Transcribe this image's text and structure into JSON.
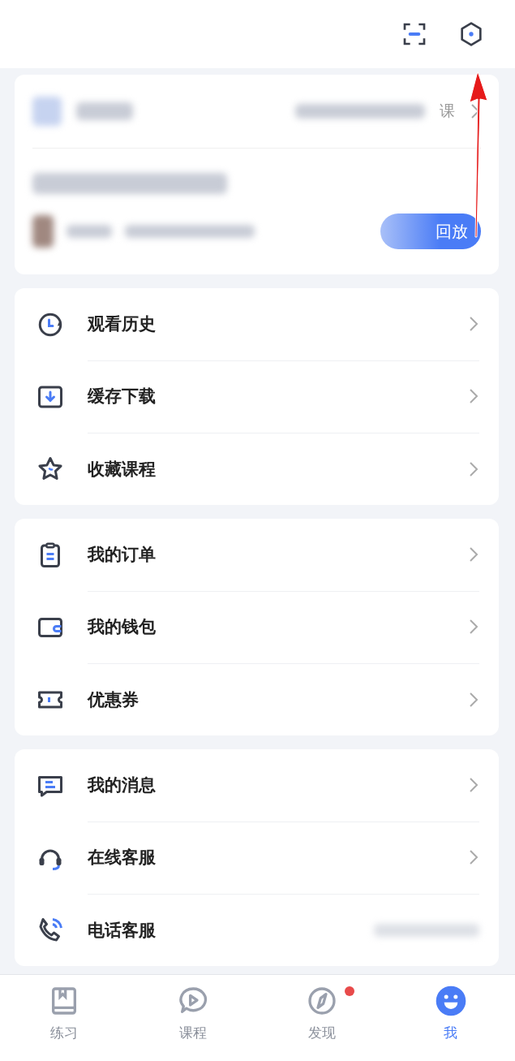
{
  "course_card": {
    "more_suffix": "课",
    "action_button": "回放"
  },
  "menu_groups": [
    {
      "items": [
        {
          "label": "观看历史",
          "chevron": true
        },
        {
          "label": "缓存下载",
          "chevron": true
        },
        {
          "label": "收藏课程",
          "chevron": true
        }
      ]
    },
    {
      "items": [
        {
          "label": "我的订单",
          "chevron": true
        },
        {
          "label": "我的钱包",
          "chevron": true
        },
        {
          "label": "优惠券",
          "chevron": true
        }
      ]
    },
    {
      "items": [
        {
          "label": "我的消息",
          "chevron": true
        },
        {
          "label": "在线客服",
          "chevron": true
        },
        {
          "label": "电话客服",
          "chevron": false
        }
      ]
    }
  ],
  "tab_bar": [
    {
      "label": "练习",
      "selected": false,
      "badge": false
    },
    {
      "label": "课程",
      "selected": false,
      "badge": false
    },
    {
      "label": "发现",
      "selected": false,
      "badge": true
    },
    {
      "label": "我",
      "selected": true,
      "badge": false
    }
  ]
}
